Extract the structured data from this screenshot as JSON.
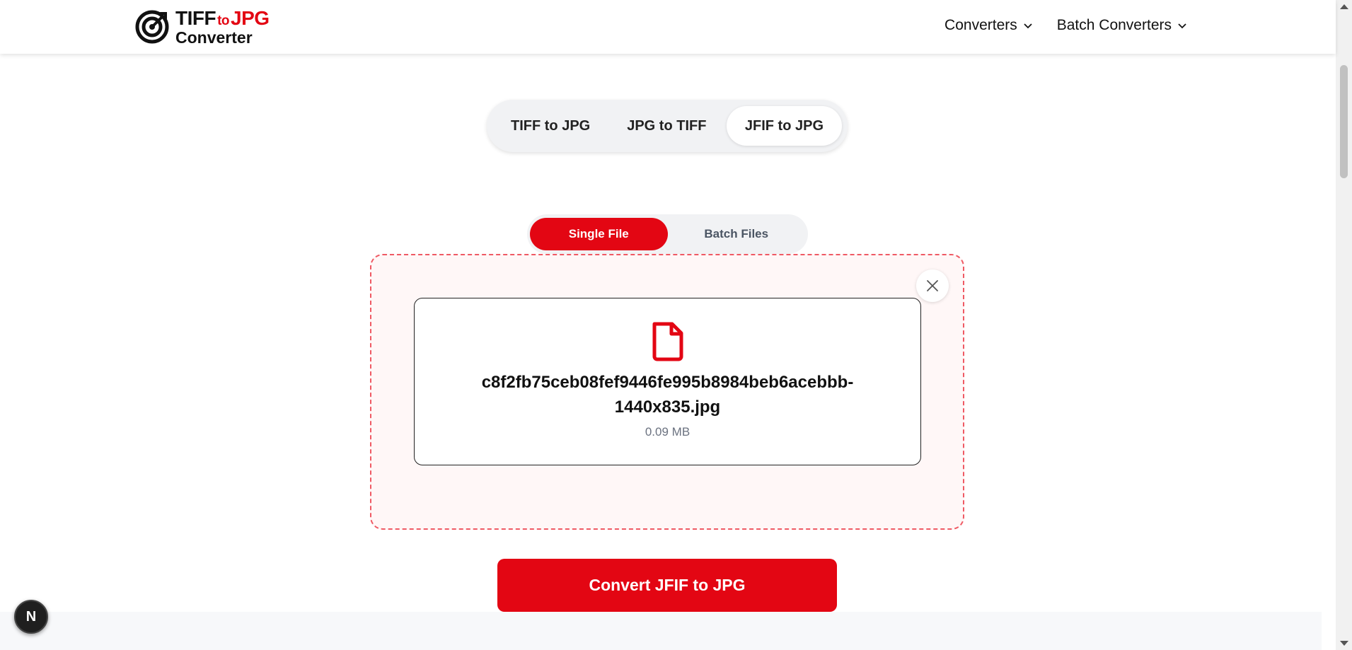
{
  "header": {
    "logo": {
      "line1_a": "TIFF",
      "line1_b": "to",
      "line1_c": "JPG",
      "line2": "Converter"
    },
    "nav": [
      {
        "label": "Converters",
        "icon": "chevron-down-icon"
      },
      {
        "label": "Batch Converters",
        "icon": "chevron-down-icon"
      }
    ]
  },
  "conversion_tabs": [
    {
      "label": "TIFF to JPG",
      "active": false
    },
    {
      "label": "JPG to TIFF",
      "active": false
    },
    {
      "label": "JFIF to JPG",
      "active": true
    }
  ],
  "mode_toggle": {
    "single": "Single File",
    "batch": "Batch Files",
    "selected": "Single File"
  },
  "file": {
    "name_line1": "c8f2fb75ceb08fef9446fe995b8984beb6acebbb-",
    "name_line2": "1440x835.jpg",
    "size": "0.09 MB",
    "icon": "file-icon"
  },
  "actions": {
    "convert_label": "Convert JFIF to JPG"
  },
  "floating_badge": {
    "label": "N"
  },
  "colors": {
    "accent": "#e30613",
    "dropzone_border": "#ef5a64",
    "dropzone_bg": "#fff7f7"
  }
}
